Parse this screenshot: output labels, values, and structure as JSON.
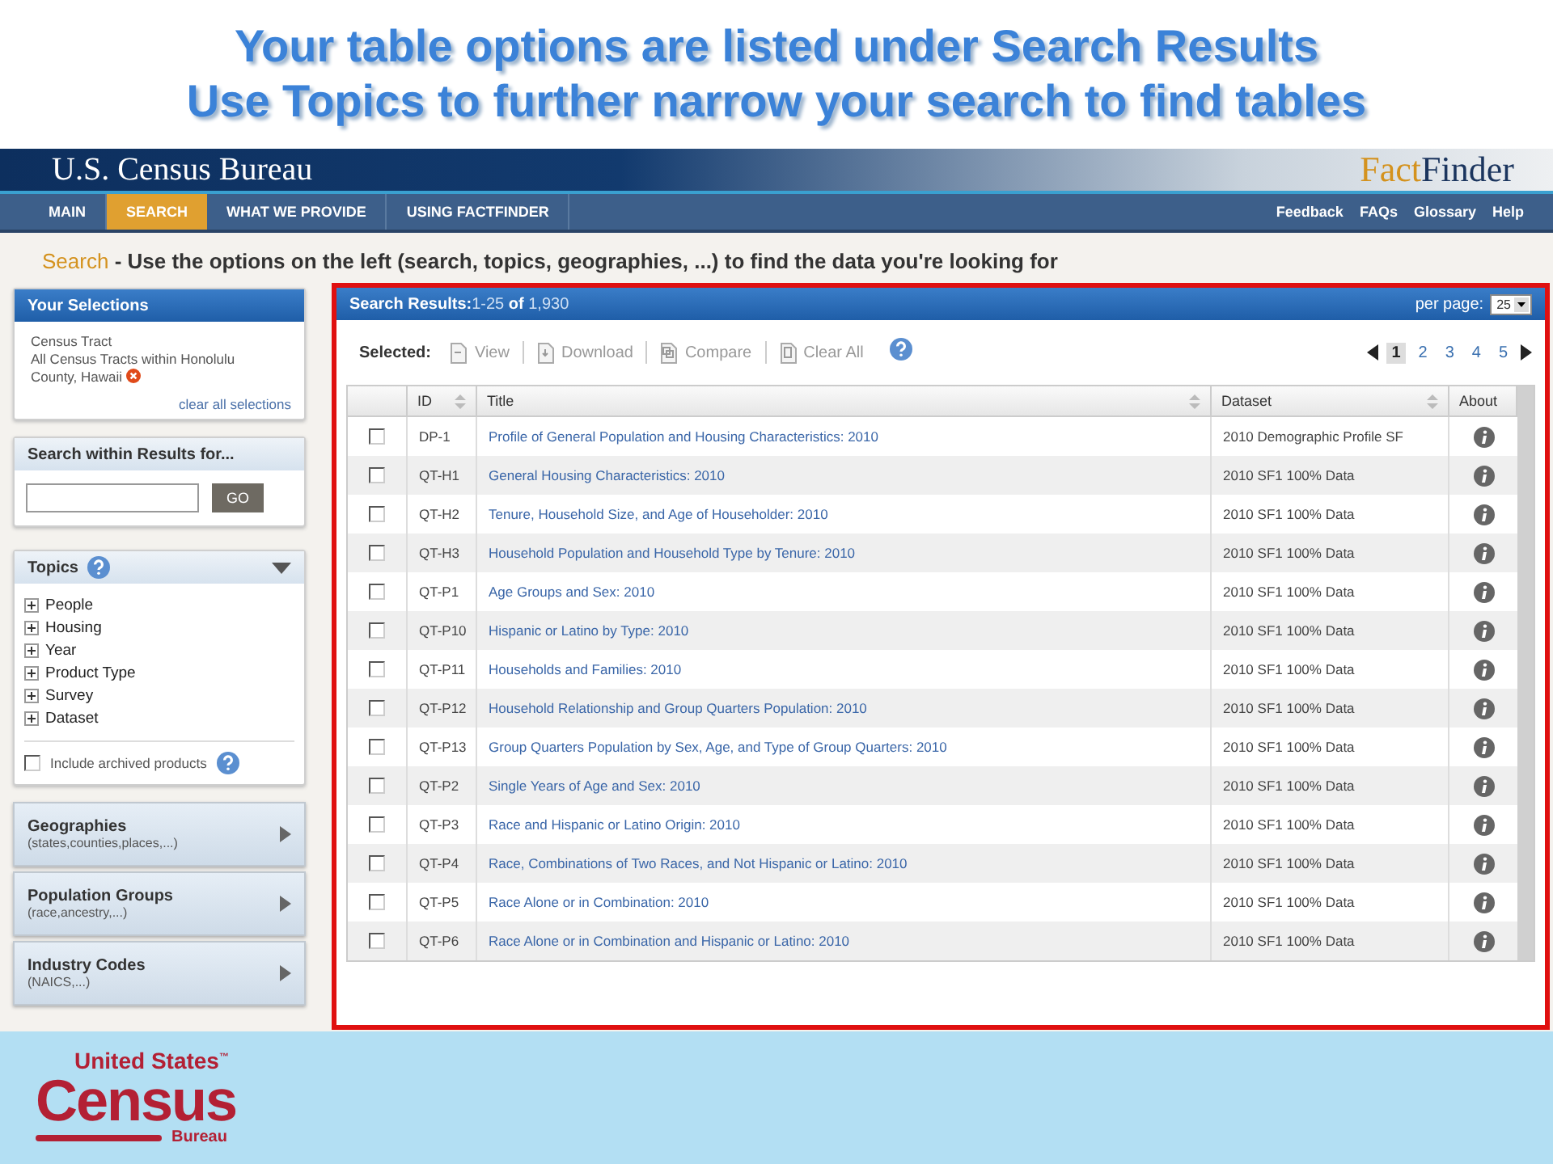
{
  "slide_title": [
    "Your table options are listed under Search Results",
    "Use Topics to further narrow your search to find tables"
  ],
  "site_header": {
    "agency": "U.S. Census Bureau",
    "product": {
      "lead": "Fact",
      "rest": "Finder"
    }
  },
  "nav": {
    "tabs": [
      {
        "label": "MAIN",
        "selected": false
      },
      {
        "label": "SEARCH",
        "selected": true
      },
      {
        "label": "WHAT WE PROVIDE",
        "selected": false
      },
      {
        "label": "USING FACTFINDER",
        "selected": false
      }
    ],
    "links": [
      "Feedback",
      "FAQs",
      "Glossary",
      "Help"
    ]
  },
  "instruction": {
    "lead": "Search",
    "text": " - Use the options on the left (search, topics, geographies, ...) to find the data you're looking for"
  },
  "sidebar": {
    "selections": {
      "title": "Your Selections",
      "type": "Census Tract",
      "value": "All Census Tracts within Honolulu County, Hawaii",
      "clear": "clear all selections"
    },
    "search_within": {
      "title": "Search within Results for...",
      "button": "GO"
    },
    "topics": {
      "title": "Topics",
      "expanded": true,
      "items": [
        "People",
        "Housing",
        "Year",
        "Product Type",
        "Survey",
        "Dataset"
      ],
      "archived": {
        "label": "Include archived products",
        "checked": false
      }
    },
    "panels": [
      {
        "title": "Geographies",
        "subtitle": "(states,counties,places,...)"
      },
      {
        "title": "Population Groups",
        "subtitle": "(race,ancestry,...)"
      },
      {
        "title": "Industry Codes",
        "subtitle": "(NAICS,...)"
      }
    ]
  },
  "results": {
    "title": "Search Results:",
    "range": "1-25",
    "of": "of",
    "total": "1,930",
    "per_page_label": "per page:",
    "per_page": "25",
    "selected_label": "Selected:",
    "actions": [
      {
        "label": "View",
        "kind": "view"
      },
      {
        "label": "Download",
        "kind": "download"
      },
      {
        "label": "Compare",
        "kind": "compare"
      },
      {
        "label": "Clear All",
        "kind": "clear"
      }
    ],
    "pages": [
      {
        "label": "1",
        "selected": true
      },
      {
        "label": "2",
        "selected": false
      },
      {
        "label": "3",
        "selected": false
      },
      {
        "label": "4",
        "selected": false
      },
      {
        "label": "5",
        "selected": false
      }
    ],
    "columns": [
      "ID",
      "Title",
      "Dataset",
      "About"
    ],
    "rows": [
      {
        "id": "DP-1",
        "title": "Profile of General Population and Housing Characteristics: 2010",
        "dataset": "2010 Demographic Profile SF",
        "checked": false
      },
      {
        "id": "QT-H1",
        "title": "General Housing Characteristics: 2010",
        "dataset": "2010 SF1 100% Data",
        "checked": false
      },
      {
        "id": "QT-H2",
        "title": "Tenure, Household Size, and Age of Householder: 2010",
        "dataset": "2010 SF1 100% Data",
        "checked": false
      },
      {
        "id": "QT-H3",
        "title": "Household Population and Household Type by Tenure: 2010",
        "dataset": "2010 SF1 100% Data",
        "checked": false
      },
      {
        "id": "QT-P1",
        "title": "Age Groups and Sex: 2010",
        "dataset": "2010 SF1 100% Data",
        "checked": false
      },
      {
        "id": "QT-P10",
        "title": "Hispanic or Latino by Type: 2010",
        "dataset": "2010 SF1 100% Data",
        "checked": false
      },
      {
        "id": "QT-P11",
        "title": "Households and Families: 2010",
        "dataset": "2010 SF1 100% Data",
        "checked": false
      },
      {
        "id": "QT-P12",
        "title": "Household Relationship and Group Quarters Population: 2010",
        "dataset": "2010 SF1 100% Data",
        "checked": false
      },
      {
        "id": "QT-P13",
        "title": "Group Quarters Population by Sex, Age, and Type of Group Quarters: 2010",
        "dataset": "2010 SF1 100% Data",
        "checked": false
      },
      {
        "id": "QT-P2",
        "title": "Single Years of Age and Sex: 2010",
        "dataset": "2010 SF1 100% Data",
        "checked": false
      },
      {
        "id": "QT-P3",
        "title": "Race and Hispanic or Latino Origin: 2010",
        "dataset": "2010 SF1 100% Data",
        "checked": false
      },
      {
        "id": "QT-P4",
        "title": "Race, Combinations of Two Races, and Not Hispanic or Latino: 2010",
        "dataset": "2010 SF1 100% Data",
        "checked": false
      },
      {
        "id": "QT-P5",
        "title": "Race Alone or in Combination: 2010",
        "dataset": "2010 SF1 100% Data",
        "checked": false
      },
      {
        "id": "QT-P6",
        "title": "Race Alone or in Combination and Hispanic or Latino: 2010",
        "dataset": "2010 SF1 100% Data",
        "checked": false
      }
    ]
  },
  "footer_logo": {
    "top": "United States",
    "tm": "™",
    "main": "Census",
    "bottom": "Bureau"
  }
}
